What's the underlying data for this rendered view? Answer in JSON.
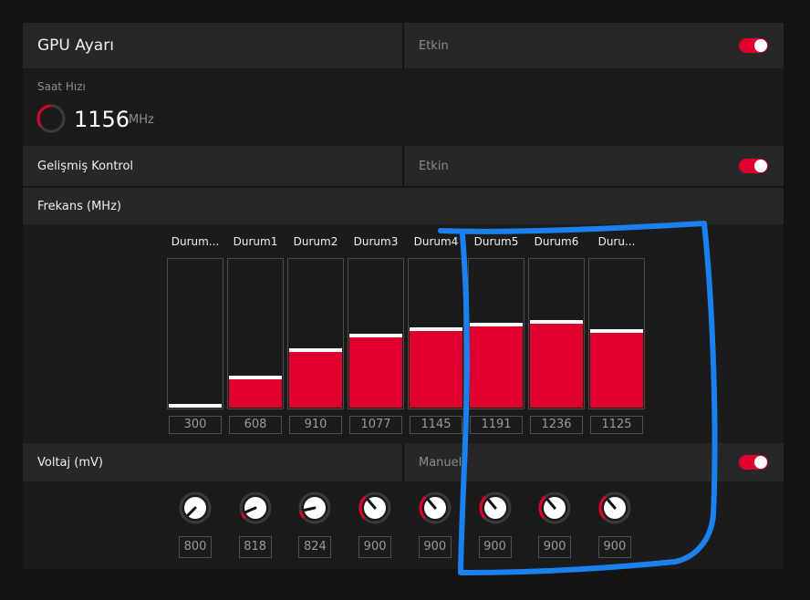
{
  "gpu": {
    "title": "GPU Ayarı",
    "status": "Etkin",
    "toggle_on": true
  },
  "clock": {
    "label": "Saat Hızı",
    "value": "1156",
    "unit": "MHz"
  },
  "advanced": {
    "label": "Gelişmiş Kontrol",
    "status": "Etkin",
    "toggle_on": true
  },
  "frequency": {
    "label": "Frekans (MHz)",
    "states": [
      {
        "name": "Durum...",
        "value": "300",
        "level": 0.0
      },
      {
        "name": "Durum1",
        "value": "608",
        "level": 0.19
      },
      {
        "name": "Durum2",
        "value": "910",
        "level": 0.37
      },
      {
        "name": "Durum3",
        "value": "1077",
        "level": 0.47
      },
      {
        "name": "Durum4",
        "value": "1145",
        "level": 0.51
      },
      {
        "name": "Durum5",
        "value": "1191",
        "level": 0.54
      },
      {
        "name": "Durum6",
        "value": "1236",
        "level": 0.56
      },
      {
        "name": "Duru...",
        "value": "1125",
        "level": 0.5
      }
    ]
  },
  "voltage": {
    "label": "Voltaj (mV)",
    "mode": "Manuel",
    "toggle_on": true,
    "knobs": [
      {
        "value": "800",
        "level": 0.0
      },
      {
        "value": "818",
        "level": 0.08
      },
      {
        "value": "824",
        "level": 0.12
      },
      {
        "value": "900",
        "level": 0.35
      },
      {
        "value": "900",
        "level": 0.35
      },
      {
        "value": "900",
        "level": 0.35
      },
      {
        "value": "900",
        "level": 0.35
      },
      {
        "value": "900",
        "level": 0.35
      }
    ]
  },
  "colors": {
    "accent": "#e0002e",
    "annotation": "#1a82f0"
  }
}
